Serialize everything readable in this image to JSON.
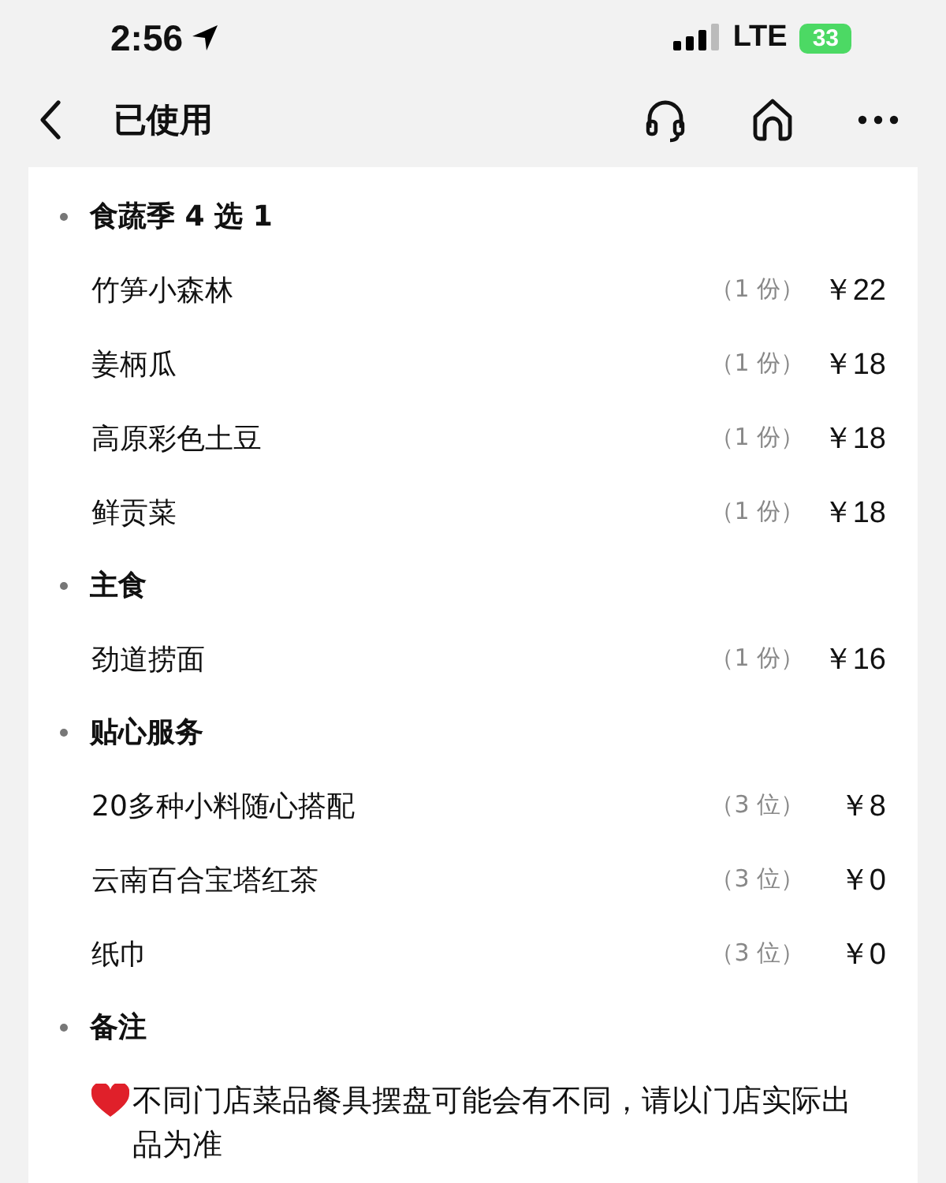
{
  "status_bar": {
    "time": "2:56",
    "network": "LTE",
    "battery": "33"
  },
  "nav": {
    "title": "已使用"
  },
  "sections": [
    {
      "kind": "items",
      "title": "食蔬季 4 选 1",
      "items": [
        {
          "name": "竹笋小森林",
          "qty": "（1 份）",
          "price": "￥22"
        },
        {
          "name": "姜柄瓜",
          "qty": "（1 份）",
          "price": "￥18"
        },
        {
          "name": "高原彩色土豆",
          "qty": "（1 份）",
          "price": "￥18"
        },
        {
          "name": "鲜贡菜",
          "qty": "（1 份）",
          "price": "￥18"
        }
      ]
    },
    {
      "kind": "items",
      "title": "主食",
      "items": [
        {
          "name": "劲道捞面",
          "qty": "（1 份）",
          "price": "￥16"
        }
      ]
    },
    {
      "kind": "items",
      "title": "贴心服务",
      "items": [
        {
          "name": "20多种小料随心搭配",
          "qty": "（3 位）",
          "price": "￥8"
        },
        {
          "name": "云南百合宝塔红茶",
          "qty": "（3 位）",
          "price": "￥0"
        },
        {
          "name": "纸巾",
          "qty": "（3 位）",
          "price": "￥0"
        }
      ]
    },
    {
      "kind": "note",
      "title": "备注",
      "text": "不同门店菜品餐具摆盘可能会有不同，请以门店实际出品为准"
    }
  ]
}
